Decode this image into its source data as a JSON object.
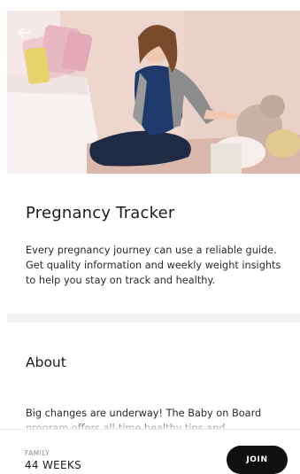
{
  "header": {
    "back_icon": "arrow-left-icon"
  },
  "hero": {
    "image": "pregnant-woman-sitting-on-floor-photo"
  },
  "program": {
    "title": "Pregnancy Tracker",
    "description": "Every pregnancy journey can use a reliable guide. Get quality information and weekly weight insights to help you stay on track and healthy."
  },
  "about": {
    "heading": "About",
    "text": "Big changes are underway! The Baby on Board program offers all-time healthy tips and..."
  },
  "footer": {
    "category_label": "FAMILY",
    "duration": "44 WEEKS",
    "join_label": "JOIN",
    "join_color": "#101010"
  }
}
